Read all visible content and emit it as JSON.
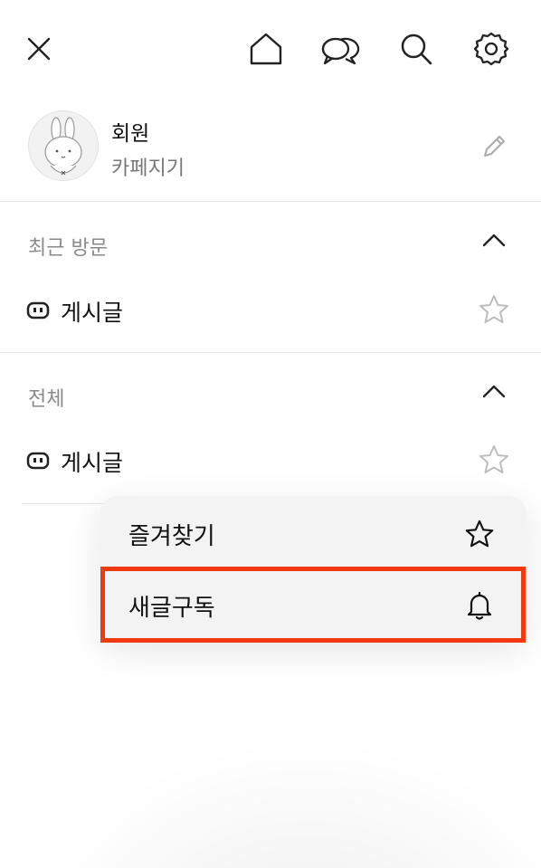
{
  "topbar": {
    "icons": [
      "close-icon",
      "home-icon",
      "chat-icon",
      "search-icon",
      "settings-icon"
    ]
  },
  "profile": {
    "name": "회원",
    "subtitle": "카페지기",
    "avatar_icon": "rabbit-avatar",
    "edit_icon": "pencil-icon"
  },
  "sections": [
    {
      "title": "최근 방문",
      "board_label": "게시글"
    },
    {
      "title": "전체",
      "board_label": "게시글"
    }
  ],
  "popup": {
    "items": [
      {
        "label": "즐겨찾기",
        "icon": "star-icon"
      },
      {
        "label": "새글구독",
        "icon": "bell-icon"
      }
    ],
    "highlight_color": "#f23a12"
  }
}
